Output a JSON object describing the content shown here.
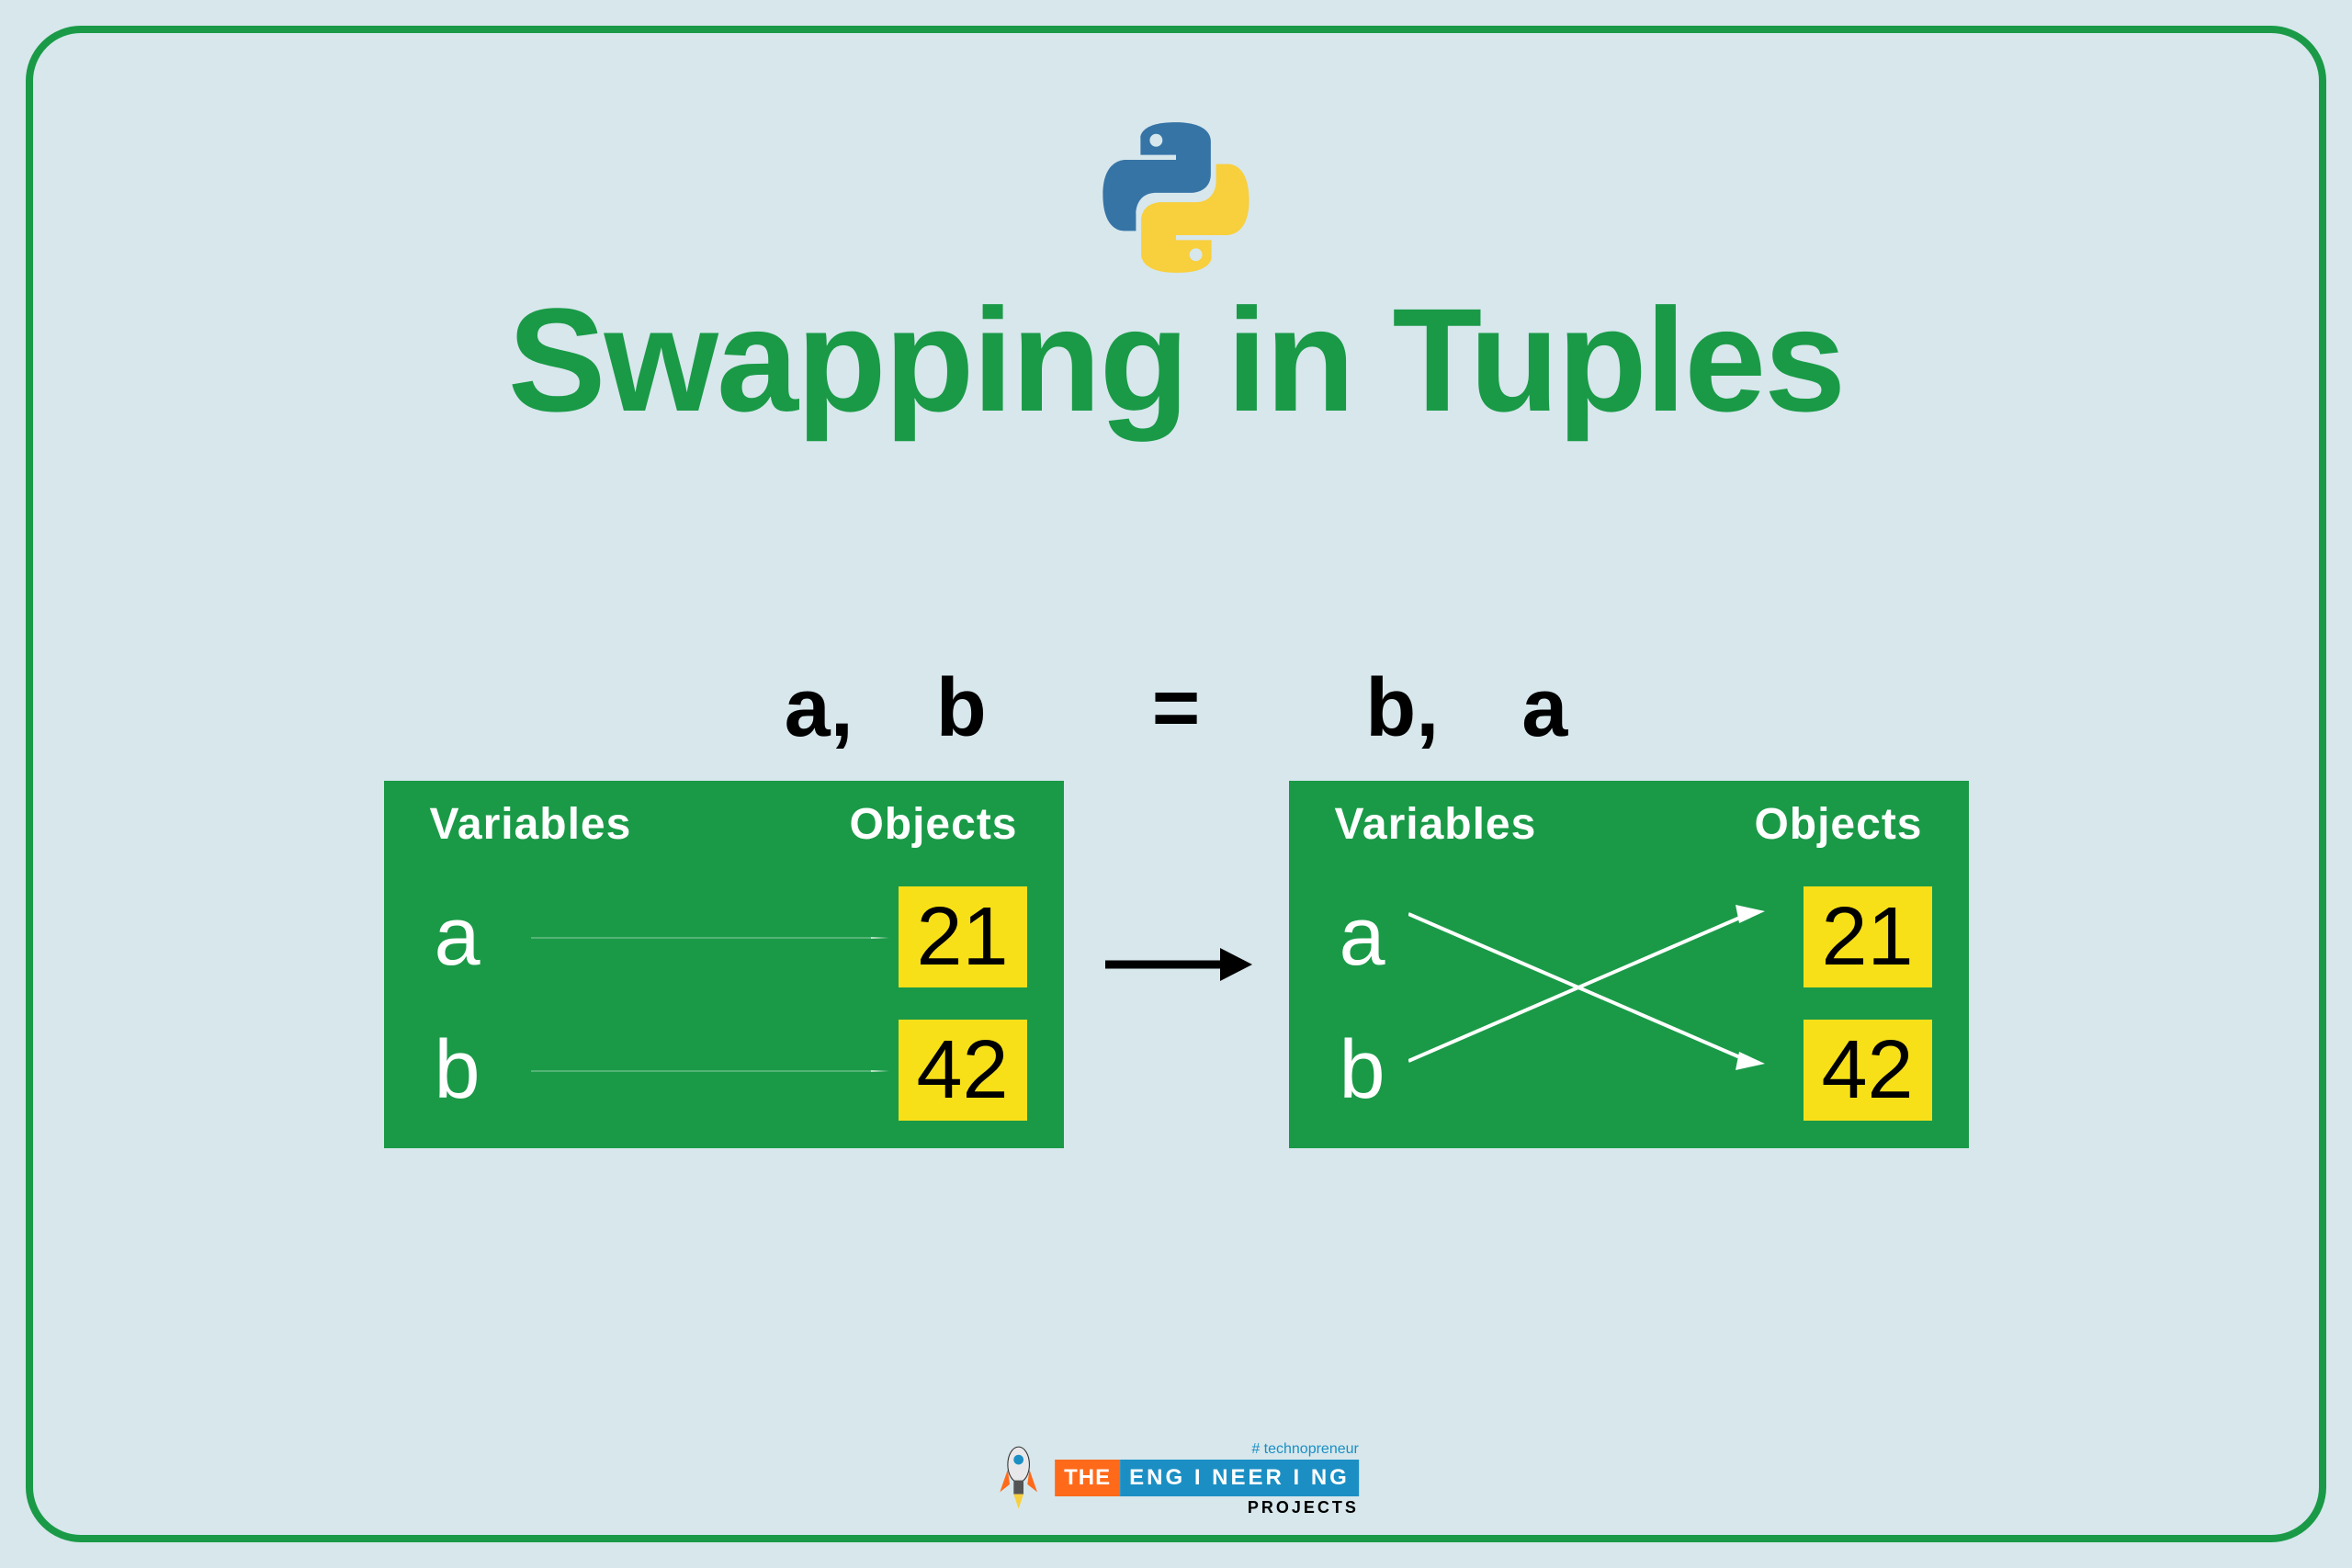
{
  "title": "Swapping in Tuples",
  "code_line": "a, b  =  b, a",
  "boxes": {
    "left": {
      "header_vars": "Variables",
      "header_objs": "Objects",
      "rows": [
        {
          "var": "a",
          "val": "21"
        },
        {
          "var": "b",
          "val": "42"
        }
      ]
    },
    "right": {
      "header_vars": "Variables",
      "header_objs": "Objects",
      "rows": [
        {
          "var": "a",
          "val": "21"
        },
        {
          "var": "b",
          "val": "42"
        }
      ]
    }
  },
  "footer": {
    "tagline": "# technopreneur",
    "the": "THE",
    "eng": "ENG I NEER I NG",
    "proj": "PROJECTS"
  },
  "colors": {
    "frame": "#1a9a47",
    "bg": "#d7e7ec",
    "box_green": "#1a9a47",
    "value_yellow": "#f7e018"
  }
}
